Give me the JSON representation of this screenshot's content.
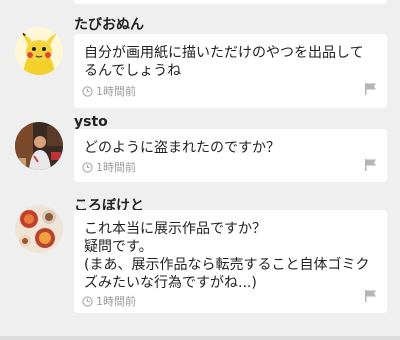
{
  "comments": [
    {
      "user": "たびおぬん",
      "text": "自分が画用紙に描いただけのやつを出品してるんでしょうね",
      "time": "1時間前",
      "avatar_icon": "pikachu-avatar"
    },
    {
      "user": "ysto",
      "text": "どのように盗まれたのですか？",
      "time": "1時間前",
      "avatar_icon": "person-photo-avatar"
    },
    {
      "user": "ころぼけと",
      "text": "これ本当に展示作品ですか？\n疑問です。\n(まあ、展示作品なら転売すること自体ゴミクズみたいな行為ですがね...)",
      "time": "1時間前",
      "avatar_icon": "food-photo-avatar"
    }
  ],
  "icons": {
    "clock": "clock-icon",
    "report": "flag-icon"
  },
  "colors": {
    "background": "#efefef",
    "card": "#ffffff",
    "meta_text": "#9a9a9a"
  }
}
